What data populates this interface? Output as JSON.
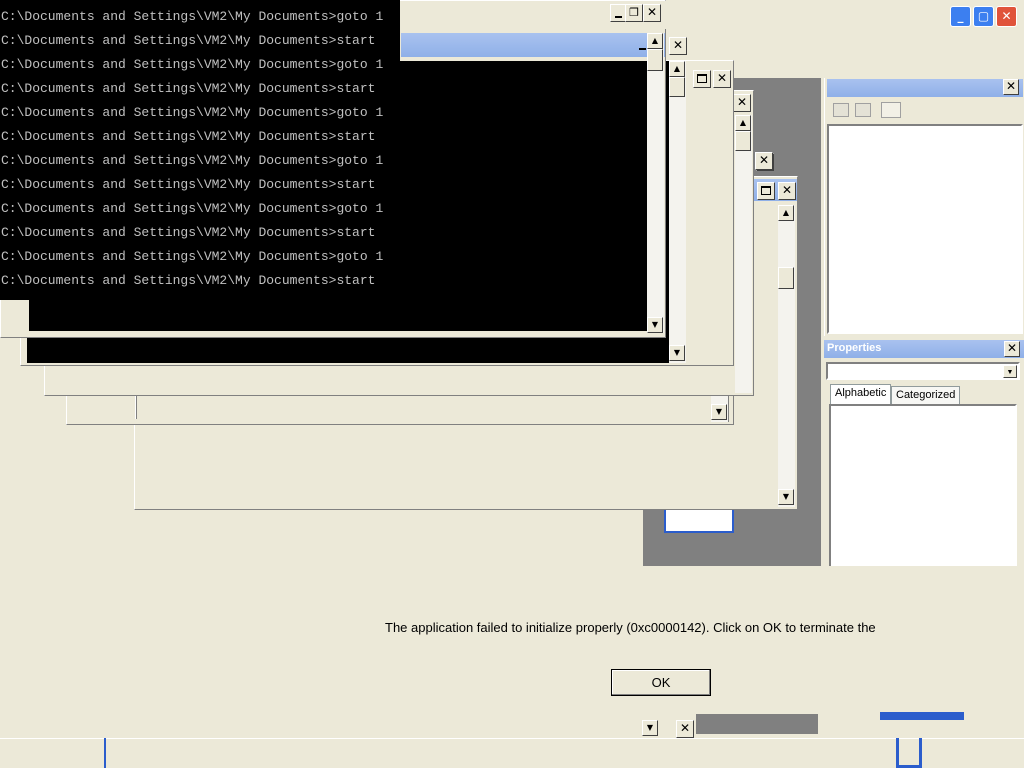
{
  "console": {
    "lines": [
      "C:\\Documents and Settings\\VM2\\My Documents>goto 1",
      "C:\\Documents and Settings\\VM2\\My Documents>start",
      "C:\\Documents and Settings\\VM2\\My Documents>goto 1",
      "C:\\Documents and Settings\\VM2\\My Documents>start",
      "C:\\Documents and Settings\\VM2\\My Documents>goto 1",
      "C:\\Documents and Settings\\VM2\\My Documents>start",
      "C:\\Documents and Settings\\VM2\\My Documents>goto 1",
      "C:\\Documents and Settings\\VM2\\My Documents>start",
      "C:\\Documents and Settings\\VM2\\My Documents>goto 1",
      "C:\\Documents and Settings\\VM2\\My Documents>start",
      "C:\\Documents and Settings\\VM2\\My Documents>goto 1",
      "C:\\Documents and Settings\\VM2\\My Documents>start"
    ]
  },
  "properties_panel": {
    "title": "Properties",
    "tabs": [
      "Alphabetic",
      "Categorized"
    ]
  },
  "error_dialog": {
    "message": "The application failed to initialize properly (0xc0000142). Click on OK to terminate the",
    "ok_label": "OK"
  },
  "icons": {
    "close": "close-icon",
    "maximize": "maximize-icon",
    "minimize": "minimize-icon",
    "restore": "restore-icon",
    "scroll_up": "scroll-up-arrow-icon",
    "scroll_down": "scroll-down-arrow-icon",
    "dropdown": "dropdown-arrow-icon"
  },
  "colors": {
    "desktop_bg": "#ece9d8",
    "titlebar_blue": "#8fb0e8",
    "xp_close_red": "#e0533a",
    "xp_blue": "#2b5dcc",
    "console_bg": "#000000",
    "console_text": "#c0c0c0"
  }
}
